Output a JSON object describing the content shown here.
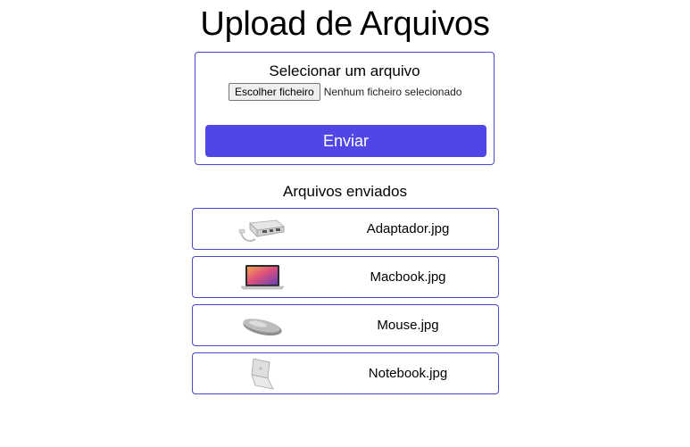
{
  "page": {
    "title": "Upload de Arquivos"
  },
  "upload": {
    "label": "Selecionar um arquivo",
    "file_button_label": "Escolher ficheiro",
    "file_status": "Nenhum ficheiro selecionado",
    "submit_label": "Enviar"
  },
  "uploaded": {
    "heading": "Arquivos enviados",
    "files": [
      {
        "name": "Adaptador.jpg",
        "thumbnail": "usb-c-adapter-image"
      },
      {
        "name": "Macbook.jpg",
        "thumbnail": "macbook-laptop-image"
      },
      {
        "name": "Mouse.jpg",
        "thumbnail": "wireless-mouse-image"
      },
      {
        "name": "Notebook.jpg",
        "thumbnail": "notebook-laptop-image"
      }
    ]
  },
  "colors": {
    "accent": "#4f46e5",
    "border": "#4a47c9",
    "text": "#000000"
  }
}
